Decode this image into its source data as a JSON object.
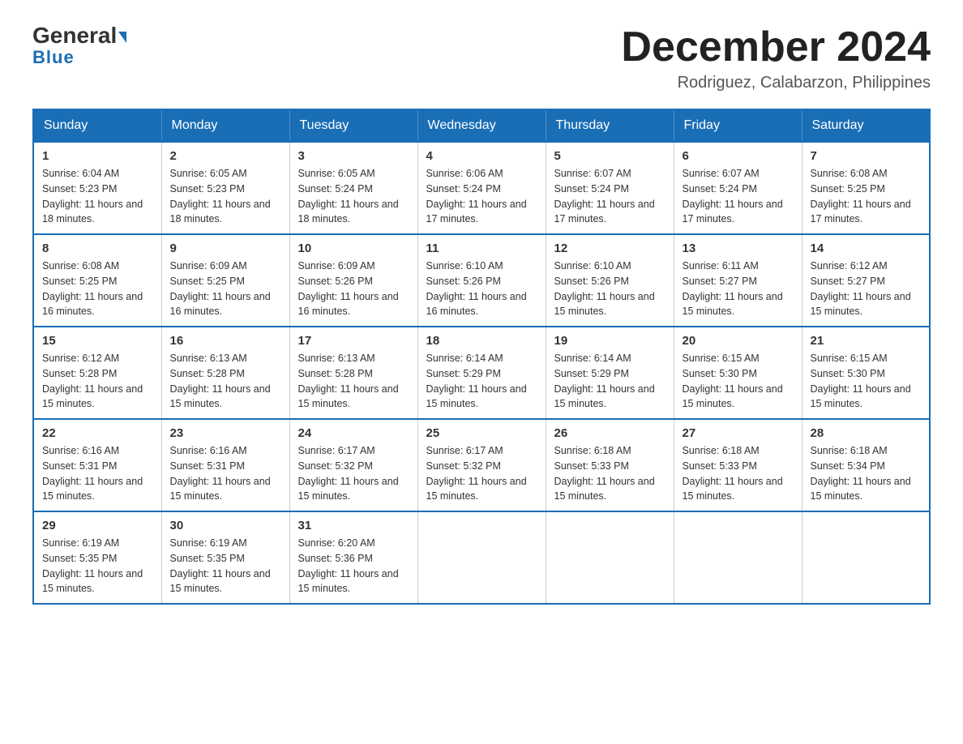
{
  "header": {
    "logo_top": "General",
    "logo_bottom": "Blue",
    "main_title": "December 2024",
    "subtitle": "Rodriguez, Calabarzon, Philippines"
  },
  "days_of_week": [
    "Sunday",
    "Monday",
    "Tuesday",
    "Wednesday",
    "Thursday",
    "Friday",
    "Saturday"
  ],
  "weeks": [
    [
      {
        "day": "1",
        "sunrise": "6:04 AM",
        "sunset": "5:23 PM",
        "daylight": "11 hours and 18 minutes."
      },
      {
        "day": "2",
        "sunrise": "6:05 AM",
        "sunset": "5:23 PM",
        "daylight": "11 hours and 18 minutes."
      },
      {
        "day": "3",
        "sunrise": "6:05 AM",
        "sunset": "5:24 PM",
        "daylight": "11 hours and 18 minutes."
      },
      {
        "day": "4",
        "sunrise": "6:06 AM",
        "sunset": "5:24 PM",
        "daylight": "11 hours and 17 minutes."
      },
      {
        "day": "5",
        "sunrise": "6:07 AM",
        "sunset": "5:24 PM",
        "daylight": "11 hours and 17 minutes."
      },
      {
        "day": "6",
        "sunrise": "6:07 AM",
        "sunset": "5:24 PM",
        "daylight": "11 hours and 17 minutes."
      },
      {
        "day": "7",
        "sunrise": "6:08 AM",
        "sunset": "5:25 PM",
        "daylight": "11 hours and 17 minutes."
      }
    ],
    [
      {
        "day": "8",
        "sunrise": "6:08 AM",
        "sunset": "5:25 PM",
        "daylight": "11 hours and 16 minutes."
      },
      {
        "day": "9",
        "sunrise": "6:09 AM",
        "sunset": "5:25 PM",
        "daylight": "11 hours and 16 minutes."
      },
      {
        "day": "10",
        "sunrise": "6:09 AM",
        "sunset": "5:26 PM",
        "daylight": "11 hours and 16 minutes."
      },
      {
        "day": "11",
        "sunrise": "6:10 AM",
        "sunset": "5:26 PM",
        "daylight": "11 hours and 16 minutes."
      },
      {
        "day": "12",
        "sunrise": "6:10 AM",
        "sunset": "5:26 PM",
        "daylight": "11 hours and 15 minutes."
      },
      {
        "day": "13",
        "sunrise": "6:11 AM",
        "sunset": "5:27 PM",
        "daylight": "11 hours and 15 minutes."
      },
      {
        "day": "14",
        "sunrise": "6:12 AM",
        "sunset": "5:27 PM",
        "daylight": "11 hours and 15 minutes."
      }
    ],
    [
      {
        "day": "15",
        "sunrise": "6:12 AM",
        "sunset": "5:28 PM",
        "daylight": "11 hours and 15 minutes."
      },
      {
        "day": "16",
        "sunrise": "6:13 AM",
        "sunset": "5:28 PM",
        "daylight": "11 hours and 15 minutes."
      },
      {
        "day": "17",
        "sunrise": "6:13 AM",
        "sunset": "5:28 PM",
        "daylight": "11 hours and 15 minutes."
      },
      {
        "day": "18",
        "sunrise": "6:14 AM",
        "sunset": "5:29 PM",
        "daylight": "11 hours and 15 minutes."
      },
      {
        "day": "19",
        "sunrise": "6:14 AM",
        "sunset": "5:29 PM",
        "daylight": "11 hours and 15 minutes."
      },
      {
        "day": "20",
        "sunrise": "6:15 AM",
        "sunset": "5:30 PM",
        "daylight": "11 hours and 15 minutes."
      },
      {
        "day": "21",
        "sunrise": "6:15 AM",
        "sunset": "5:30 PM",
        "daylight": "11 hours and 15 minutes."
      }
    ],
    [
      {
        "day": "22",
        "sunrise": "6:16 AM",
        "sunset": "5:31 PM",
        "daylight": "11 hours and 15 minutes."
      },
      {
        "day": "23",
        "sunrise": "6:16 AM",
        "sunset": "5:31 PM",
        "daylight": "11 hours and 15 minutes."
      },
      {
        "day": "24",
        "sunrise": "6:17 AM",
        "sunset": "5:32 PM",
        "daylight": "11 hours and 15 minutes."
      },
      {
        "day": "25",
        "sunrise": "6:17 AM",
        "sunset": "5:32 PM",
        "daylight": "11 hours and 15 minutes."
      },
      {
        "day": "26",
        "sunrise": "6:18 AM",
        "sunset": "5:33 PM",
        "daylight": "11 hours and 15 minutes."
      },
      {
        "day": "27",
        "sunrise": "6:18 AM",
        "sunset": "5:33 PM",
        "daylight": "11 hours and 15 minutes."
      },
      {
        "day": "28",
        "sunrise": "6:18 AM",
        "sunset": "5:34 PM",
        "daylight": "11 hours and 15 minutes."
      }
    ],
    [
      {
        "day": "29",
        "sunrise": "6:19 AM",
        "sunset": "5:35 PM",
        "daylight": "11 hours and 15 minutes."
      },
      {
        "day": "30",
        "sunrise": "6:19 AM",
        "sunset": "5:35 PM",
        "daylight": "11 hours and 15 minutes."
      },
      {
        "day": "31",
        "sunrise": "6:20 AM",
        "sunset": "5:36 PM",
        "daylight": "11 hours and 15 minutes."
      },
      {
        "day": "",
        "sunrise": "",
        "sunset": "",
        "daylight": ""
      },
      {
        "day": "",
        "sunrise": "",
        "sunset": "",
        "daylight": ""
      },
      {
        "day": "",
        "sunrise": "",
        "sunset": "",
        "daylight": ""
      },
      {
        "day": "",
        "sunrise": "",
        "sunset": "",
        "daylight": ""
      }
    ]
  ],
  "labels": {
    "sunrise_prefix": "Sunrise: ",
    "sunset_prefix": "Sunset: ",
    "daylight_prefix": "Daylight: "
  }
}
